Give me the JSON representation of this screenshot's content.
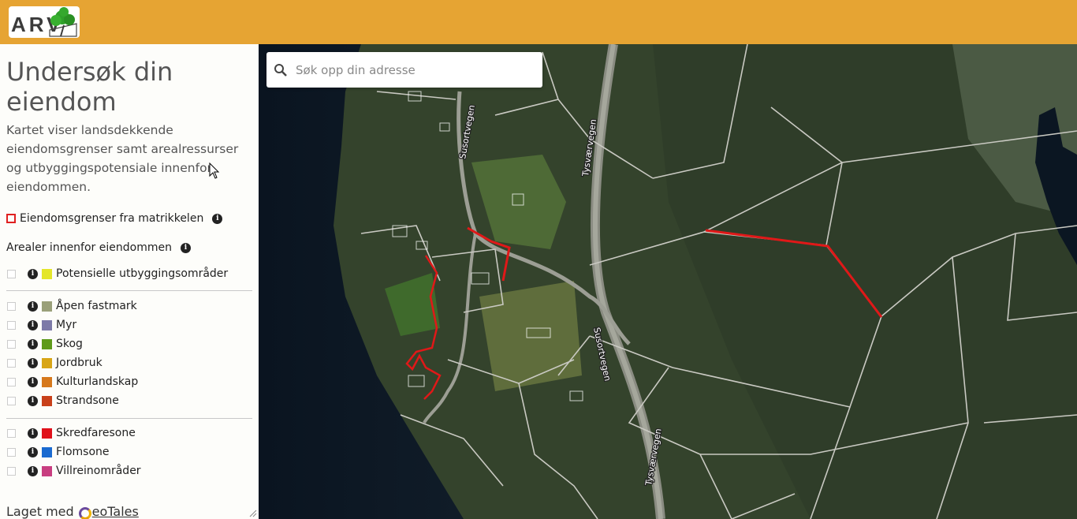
{
  "header": {
    "logo_text": "ARV",
    "brand_color": "#e6a433"
  },
  "sidebar": {
    "title": "Undersøk din eiendom",
    "intro": "Kartet viser landsdekkende eiendomsgrenser samt arealressurser og utbyggingspotensiale innenfor eiendommen.",
    "matrikkel_label": "Eiendomsgrenser fra matrikkelen",
    "section_label": "Arealer innenfor eiendommen",
    "group1": [
      {
        "label": "Potensielle utbyggingsområder",
        "color": "#e4e62a"
      }
    ],
    "group2": [
      {
        "label": "Åpen fastmark",
        "color": "#9aa07a"
      },
      {
        "label": "Myr",
        "color": "#7d7aa8"
      },
      {
        "label": "Skog",
        "color": "#5e9a1a"
      },
      {
        "label": "Jordbruk",
        "color": "#d8a516"
      },
      {
        "label": "Kulturlandskap",
        "color": "#d6781c"
      },
      {
        "label": "Strandsone",
        "color": "#c8401a"
      }
    ],
    "group3": [
      {
        "label": "Skredfaresone",
        "color": "#e0101a"
      },
      {
        "label": "Flomsone",
        "color": "#1a6ad0"
      },
      {
        "label": "Villreinområder",
        "color": "#c83e80"
      }
    ],
    "footer_prefix": "Laget med",
    "footer_brand": "eoTales"
  },
  "map": {
    "search_placeholder": "Søk opp din adresse",
    "road_labels": [
      "Susortvegen",
      "Tysværvegen",
      "Susortvegen",
      "Tysværvegen"
    ]
  }
}
